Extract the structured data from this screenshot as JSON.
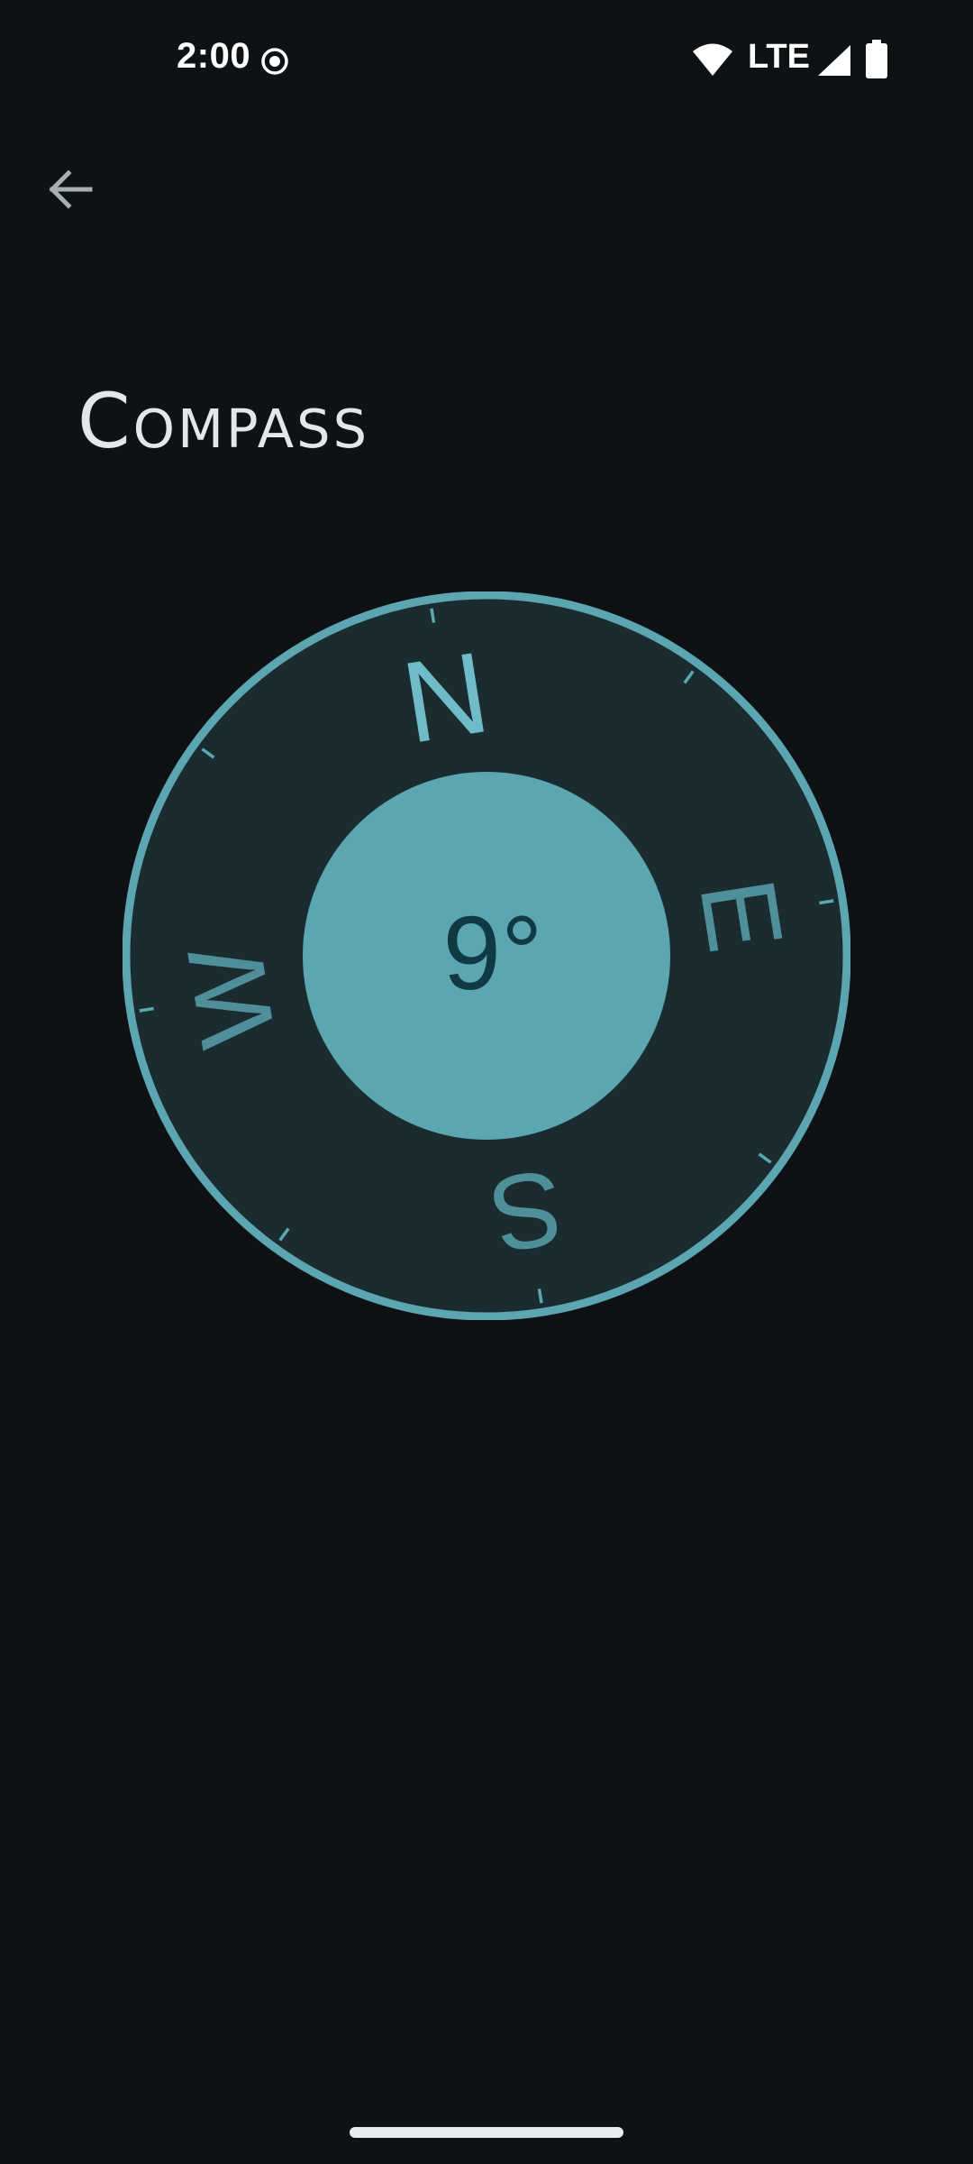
{
  "status_bar": {
    "time": "2:00",
    "network_label": "LTE",
    "icons": [
      "location-icon",
      "wifi-icon",
      "signal-icon",
      "battery-icon"
    ]
  },
  "header": {
    "back_icon": "arrow-back-icon",
    "title": "Compass"
  },
  "compass": {
    "heading_degrees": 9,
    "heading_label": "9°",
    "cardinals": [
      "N",
      "E",
      "S",
      "W"
    ],
    "colors": {
      "ring": "#5ca6b2",
      "face": "#1b2c31",
      "center": "#5ca6b2",
      "north_label": "#6fbcc8",
      "cardinal_label": "#4f8f99",
      "heading_text": "#0f3a44"
    }
  }
}
